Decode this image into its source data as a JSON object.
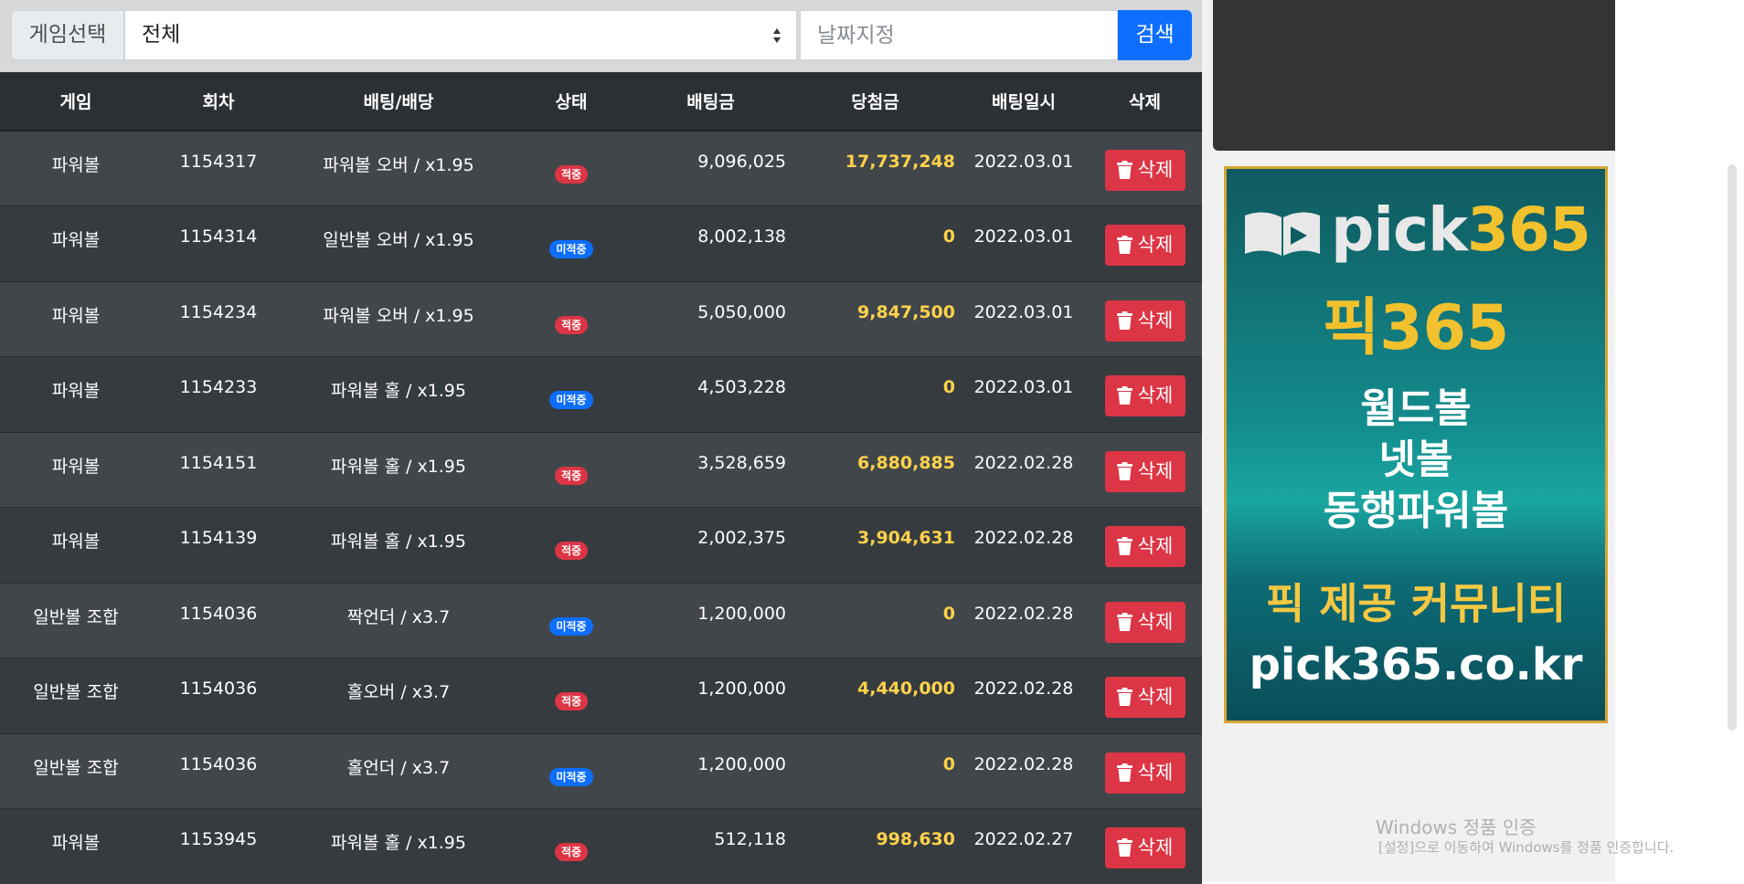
{
  "filter": {
    "label": "게임선택",
    "selected": "전체",
    "date_placeholder": "날짜지정",
    "search_label": "검색"
  },
  "table": {
    "headers": [
      "게임",
      "회차",
      "배팅/배당",
      "상태",
      "배팅금",
      "당첨금",
      "배팅일시",
      "삭제"
    ],
    "rows": [
      {
        "game": "파워볼",
        "round": "1154317",
        "bet": "파워볼 오버 / x1.95",
        "status": "적중",
        "status_type": "hit",
        "amount": "9,096,025",
        "win": "17,737,248",
        "date": "2022.03.01",
        "delete": "삭제"
      },
      {
        "game": "파워볼",
        "round": "1154314",
        "bet": "일반볼 오버 / x1.95",
        "status": "미적중",
        "status_type": "miss",
        "amount": "8,002,138",
        "win": "0",
        "date": "2022.03.01",
        "delete": "삭제"
      },
      {
        "game": "파워볼",
        "round": "1154234",
        "bet": "파워볼 오버 / x1.95",
        "status": "적중",
        "status_type": "hit",
        "amount": "5,050,000",
        "win": "9,847,500",
        "date": "2022.03.01",
        "delete": "삭제"
      },
      {
        "game": "파워볼",
        "round": "1154233",
        "bet": "파워볼 홀 / x1.95",
        "status": "미적중",
        "status_type": "miss",
        "amount": "4,503,228",
        "win": "0",
        "date": "2022.03.01",
        "delete": "삭제"
      },
      {
        "game": "파워볼",
        "round": "1154151",
        "bet": "파워볼 홀 / x1.95",
        "status": "적중",
        "status_type": "hit",
        "amount": "3,528,659",
        "win": "6,880,885",
        "date": "2022.02.28",
        "delete": "삭제"
      },
      {
        "game": "파워볼",
        "round": "1154139",
        "bet": "파워볼 홀 / x1.95",
        "status": "적중",
        "status_type": "hit",
        "amount": "2,002,375",
        "win": "3,904,631",
        "date": "2022.02.28",
        "delete": "삭제"
      },
      {
        "game": "일반볼 조합",
        "round": "1154036",
        "bet": "짝언더 / x3.7",
        "status": "미적중",
        "status_type": "miss",
        "amount": "1,200,000",
        "win": "0",
        "date": "2022.02.28",
        "delete": "삭제"
      },
      {
        "game": "일반볼 조합",
        "round": "1154036",
        "bet": "홀오버 / x3.7",
        "status": "적중",
        "status_type": "hit",
        "amount": "1,200,000",
        "win": "4,440,000",
        "date": "2022.02.28",
        "delete": "삭제"
      },
      {
        "game": "일반볼 조합",
        "round": "1154036",
        "bet": "홀언더 / x3.7",
        "status": "미적중",
        "status_type": "miss",
        "amount": "1,200,000",
        "win": "0",
        "date": "2022.02.28",
        "delete": "삭제"
      },
      {
        "game": "파워볼",
        "round": "1153945",
        "bet": "파워볼 홀 / x1.95",
        "status": "적중",
        "status_type": "hit",
        "amount": "512,118",
        "win": "998,630",
        "date": "2022.02.27",
        "delete": "삭제"
      }
    ]
  },
  "ad": {
    "logo_a": "pick",
    "logo_b": "365",
    "title_kr": "픽365",
    "lines": [
      "월드볼",
      "넷볼",
      "동행파워볼"
    ],
    "tagline": "픽 제공 커뮤니티",
    "url": "pick365.co.kr"
  },
  "watermark": {
    "line1": "Windows 정품 인증",
    "line2": "[설정]으로 이동하여 Windows를 정품 인증합니다."
  },
  "colors": {
    "win_amount": "#ffd24a",
    "hit_badge": "#dc3545",
    "miss_badge": "#0d6efd",
    "delete_button": "#dc3545",
    "search_button": "#0d6efd"
  }
}
